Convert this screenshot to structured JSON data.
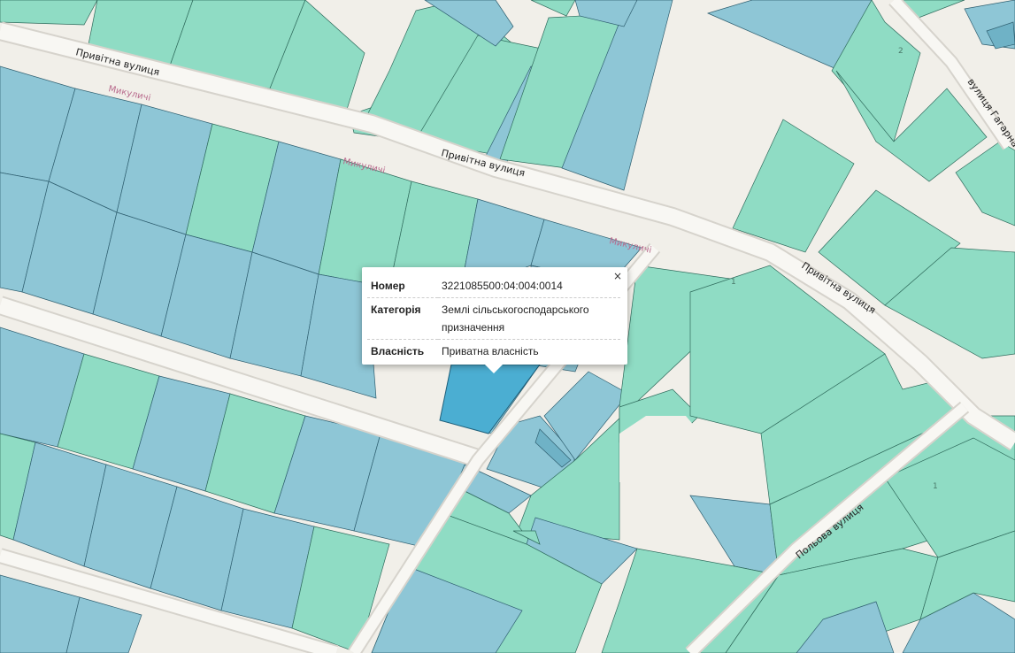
{
  "map": {
    "streets": [
      {
        "id": "pryvitna-1",
        "label": "Привітна вулиця"
      },
      {
        "id": "pryvitna-2",
        "label": "Привітна вулиця"
      },
      {
        "id": "pryvitna-3",
        "label": "Привітна вулиця"
      },
      {
        "id": "gagarina",
        "label": "вулиця Гагарна"
      },
      {
        "id": "polova",
        "label": "Польова вулиця"
      }
    ],
    "places": [
      {
        "id": "mykulychi-1",
        "label": "Микуличі"
      },
      {
        "id": "mykulychi-2",
        "label": "Микуличі"
      },
      {
        "id": "mykulychi-3",
        "label": "Микуличі"
      }
    ],
    "building_numbers": [
      "1",
      "1",
      "2"
    ],
    "colors": {
      "background": "#f1efe9",
      "parcel_green": "#8fdcc4",
      "parcel_blue": "#8ec6d6",
      "parcel_selected": "#4baed2",
      "road": "#f8f7f3"
    }
  },
  "popup": {
    "close_label": "×",
    "rows": [
      {
        "key": "Номер",
        "value": "3221085500:04:004:0014"
      },
      {
        "key": "Категорія",
        "value": "Землі сільськогосподарського призначення"
      },
      {
        "key": "Власність",
        "value": "Приватна власність"
      }
    ]
  }
}
